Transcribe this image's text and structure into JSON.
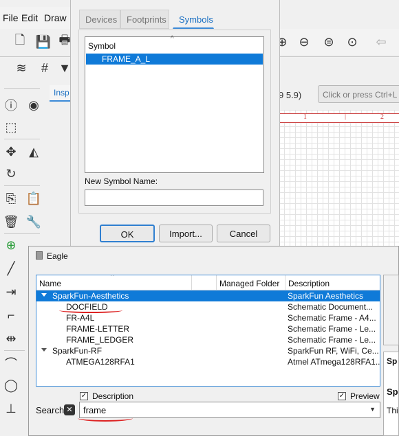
{
  "menu": {
    "file": "File",
    "edit": "Edit",
    "draw": "Draw"
  },
  "coords": "9 5.9)",
  "command_placeholder": "Click or press Ctrl+L t",
  "inspector_tab": "Insp",
  "ruler": {
    "mark1": "1",
    "mark2": "2"
  },
  "symbols_dialog": {
    "tabs": [
      "Devices",
      "Footprints",
      "Symbols"
    ],
    "list_header": "Symbol",
    "symbols": [
      "FRAME_A_L"
    ],
    "new_name_label": "New Symbol Name:",
    "new_name_value": "",
    "ok": "OK",
    "import": "Import...",
    "cancel": "Cancel"
  },
  "eagle_dialog": {
    "title": "Eagle",
    "columns": [
      "Name",
      "Managed Folder",
      "Description"
    ],
    "rows": [
      {
        "name": "SparkFun-Aesthetics",
        "folder": "",
        "desc": "SparkFun Aesthetics"
      },
      {
        "name": "DOCFIELD",
        "folder": "",
        "desc": "Schematic Document..."
      },
      {
        "name": "FR-A4L",
        "folder": "",
        "desc": "Schematic Frame - A4..."
      },
      {
        "name": "FRAME-LETTER",
        "folder": "",
        "desc": "Schematic Frame - Le..."
      },
      {
        "name": "FRAME_LEDGER",
        "folder": "",
        "desc": "Schematic Frame - Le..."
      },
      {
        "name": "SparkFun-RF",
        "folder": "",
        "desc": "SparkFun RF, WiFi, Ce..."
      },
      {
        "name": "ATMEGA128RFA1",
        "folder": "",
        "desc": "Atmel ATmega128RFA1..."
      }
    ],
    "description_checkbox": "Description",
    "preview_checkbox": "Preview",
    "search_label": "Search",
    "search_value": "frame",
    "side_text1": "Sp",
    "side_text2": "Sp",
    "side_text3": "Thi"
  },
  "colors": {
    "accent": "#0f7ad8",
    "annotation": "#dd2222"
  }
}
